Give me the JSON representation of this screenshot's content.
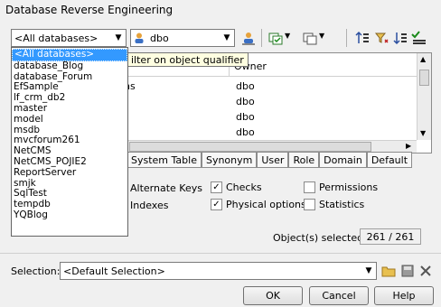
{
  "window": {
    "title": "Database Reverse Engineering"
  },
  "toolbar": {
    "database_combo_value": "<All databases>",
    "owner_combo_value": "dbo",
    "tooltip": "ilter on object qualifier"
  },
  "objects_table": {
    "owner_header": "Owner",
    "rows": [
      {
        "name_fragment": "ns",
        "owner": "dbo"
      },
      {
        "name_fragment": "",
        "owner": "dbo"
      },
      {
        "name_fragment": "",
        "owner": "dbo"
      },
      {
        "name_fragment": "",
        "owner": "dbo"
      }
    ]
  },
  "tabs": [
    "System Table",
    "Synonym",
    "User",
    "Role",
    "Domain",
    "Default"
  ],
  "options": {
    "alternate_keys": "Alternate Keys",
    "indexes": "Indexes",
    "checks": {
      "label": "Checks",
      "checked": true
    },
    "physical_options": {
      "label": "Physical options",
      "checked": true
    },
    "permissions": {
      "label": "Permissions",
      "checked": false
    },
    "statistics": {
      "label": "Statistics",
      "checked": false
    }
  },
  "selected": {
    "label": "Object(s) selected:",
    "value": "261 / 261"
  },
  "selection": {
    "label": "Selection:",
    "value": "<Default Selection>"
  },
  "buttons": {
    "ok": "OK",
    "cancel": "Cancel",
    "help": "Help"
  },
  "database_dropdown": {
    "items": [
      "<All databases>",
      "database_Blog",
      "database_Forum",
      "EfSample",
      "lf_crm_db2",
      "master",
      "model",
      "msdb",
      "mvcforum261",
      "NetCMS",
      "NetCMS_POJIE2",
      "ReportServer",
      "smjk",
      "SqlTest",
      "tempdb",
      "YQBlog"
    ],
    "selected_index": 0
  }
}
